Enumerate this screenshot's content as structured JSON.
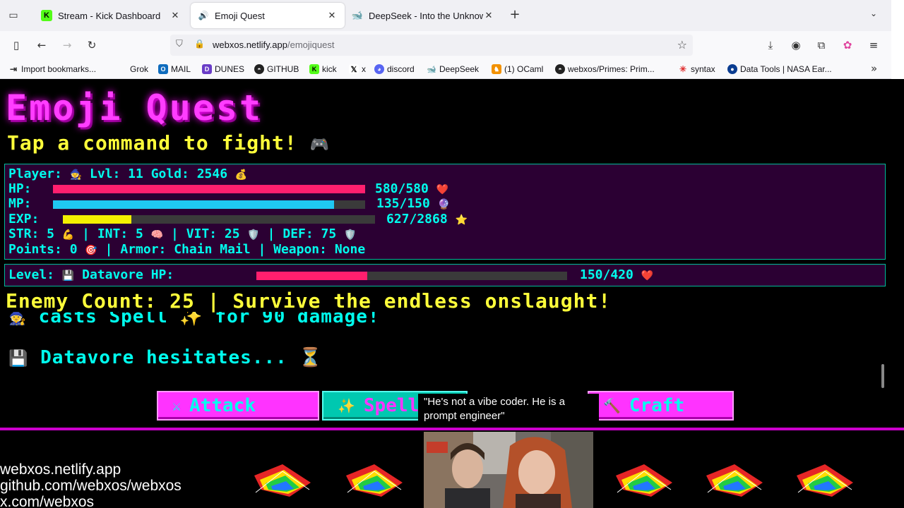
{
  "browser": {
    "tabs": [
      {
        "label": "Stream - Kick Dashboard",
        "favicon": "K",
        "color": "#53fc18"
      },
      {
        "label": "Emoji Quest",
        "favicon": "speaker-icon",
        "color": "#333333"
      },
      {
        "label": "DeepSeek - Into the Unknown",
        "favicon": "deepseek-icon",
        "color": "#4d6bfe"
      }
    ],
    "url_domain": "webxos.netlify.app",
    "url_path": "/emojiquest",
    "bookmarks": [
      {
        "label": "Import bookmarks...",
        "icon": "import-icon"
      },
      {
        "label": "Grok",
        "icon": "grok-icon"
      },
      {
        "label": "MAIL",
        "icon": "mail-icon"
      },
      {
        "label": "DUNES",
        "icon": "dunes-icon"
      },
      {
        "label": "GITHUB",
        "icon": "github-icon"
      },
      {
        "label": "kick",
        "icon": "kick-icon"
      },
      {
        "label": "x",
        "icon": "x-icon"
      },
      {
        "label": "discord",
        "icon": "discord-icon"
      },
      {
        "label": "DeepSeek",
        "icon": "deepseek-icon"
      },
      {
        "label": "(1) OCaml",
        "icon": "ocaml-icon"
      },
      {
        "label": "webxos/Primes: Prim...",
        "icon": "github-icon"
      },
      {
        "label": "syntax",
        "icon": "syntax-icon"
      },
      {
        "label": "Data Tools | NASA Ear...",
        "icon": "nasa-icon"
      }
    ]
  },
  "game": {
    "title": "Emoji Quest",
    "subtitle": "Tap a command to fight!",
    "subtitle_emoji": "🎮",
    "player": {
      "label": "Player:",
      "avatar": "🧙",
      "level_text": "Lvl: 11",
      "gold_text": "Gold: 2546",
      "gold_emoji": "💰",
      "hp_label": "HP:",
      "hp_text": "580/580",
      "hp_emoji": "❤️",
      "hp_fraction": 1.0,
      "mp_label": "MP:",
      "mp_text": "135/150",
      "mp_emoji": "🔮",
      "mp_fraction": 0.9,
      "exp_label": "EXP:",
      "exp_text": "627/2868",
      "exp_emoji": "⭐",
      "exp_fraction": 0.22,
      "str_text": "STR: 5",
      "str_emoji": "💪",
      "int_text": "INT: 5",
      "int_emoji": "🧠",
      "vit_text": "VIT: 25",
      "vit_emoji": "🛡️",
      "def_text": "DEF: 75",
      "def_emoji": "🛡️",
      "points_text": "Points: 0",
      "points_emoji": "🎯",
      "armor_text": "Armor: Chain Mail",
      "weapon_text": "Weapon: None",
      "separator": "|"
    },
    "enemy": {
      "level_label": "Level:",
      "emoji": "💾",
      "name_hp_label": "Datavore HP:",
      "hp_text": "150/420",
      "hp_emoji": "❤️",
      "hp_fraction": 0.357
    },
    "enemy_count_text": "Enemy Count: 25 | Survive the endless onslaught!",
    "log": [
      {
        "emoji": "🧙",
        "text": "casts Spell ✨ for 90 damage!"
      },
      {
        "emoji": "💾",
        "text": "Datavore hesitates... ⏳"
      }
    ],
    "commands": [
      {
        "label": "Attack",
        "icon": "⚔"
      },
      {
        "label": "Spell",
        "icon": "✨"
      },
      {
        "label": "Craft",
        "icon": "🔨"
      }
    ]
  },
  "overlay": {
    "quote": "\"He's not a vibe coder. He is a prompt engineer\"",
    "links": [
      "webxos.netlify.app",
      "github.com/webxos/webxos",
      "x.com/webxos"
    ]
  }
}
